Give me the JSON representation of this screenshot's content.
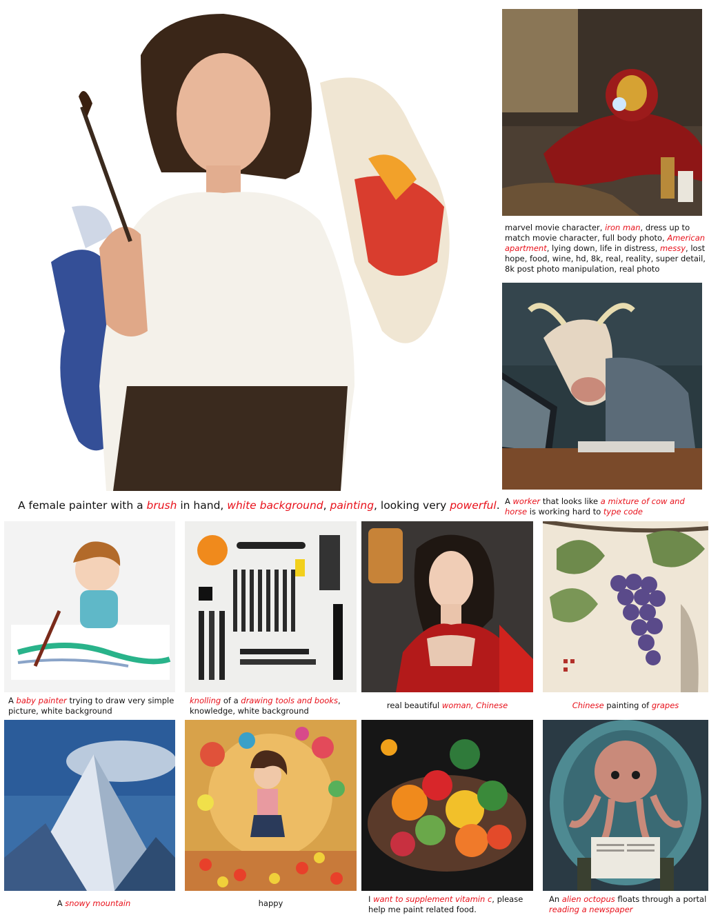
{
  "main": {
    "caption": {
      "p1": "A female painter with a ",
      "h1": "brush",
      "p2": " in hand, ",
      "h2": "white background",
      "p3": ", ",
      "h3": "painting",
      "p4": ", looking very ",
      "h4": "powerful",
      "p5": "."
    }
  },
  "side": [
    {
      "caption": {
        "p1": "marvel movie character, ",
        "h1": "iron man",
        "p2": ", dress up to match movie character, full body photo, ",
        "h2": "American apartment",
        "p3": ", lying down, life in distress, ",
        "h3": "messy",
        "p4": ", lost hope, food, wine, hd, 8k, real, reality, super detail, 8k post photo manipulation, real photo"
      }
    },
    {
      "caption": {
        "p1": "A ",
        "h1": "worker",
        "p2": " that looks like ",
        "h2": "a mixture of cow and horse",
        "p3": " is working hard to ",
        "h3": "type code"
      }
    }
  ],
  "grid_row1": [
    {
      "caption": {
        "p1": "A ",
        "h1": "baby painter",
        "p2": " trying to draw very simple picture, white background"
      }
    },
    {
      "caption": {
        "h1": "knolling",
        "p1": " of a ",
        "h2": "drawing tools and books",
        "p2": ", knowledge, white background"
      }
    },
    {
      "caption": {
        "p1": "real beautiful ",
        "h1": "woman, Chinese"
      }
    },
    {
      "caption": {
        "h1": "Chinese",
        "p1": " painting of ",
        "h2": "grapes"
      }
    }
  ],
  "grid_row2": [
    {
      "caption": {
        "p1": "A ",
        "h1": "snowy mountain"
      }
    },
    {
      "caption": {
        "p1": "happy"
      }
    },
    {
      "caption": {
        "p1": "I ",
        "h1": "want to supplement vitamin c",
        "p2": ", please help me paint related food."
      }
    },
    {
      "caption": {
        "p1": "An ",
        "h1": "alien octopus",
        "p2": " floats through a portal ",
        "h2": "reading a newspaper"
      }
    }
  ],
  "colors": {
    "highlight": "#e8101a",
    "text": "#111111"
  }
}
